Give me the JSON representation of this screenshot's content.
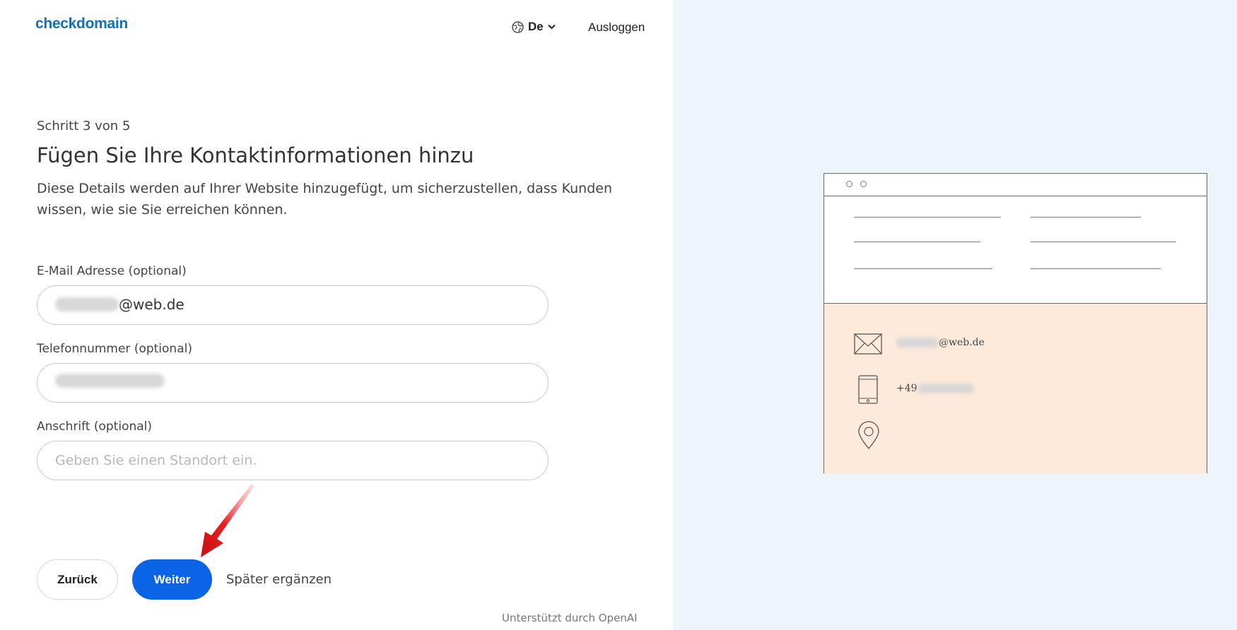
{
  "header": {
    "logo": "checkdomain",
    "language": "De",
    "logout_label": "Ausloggen"
  },
  "form": {
    "step": "Schritt 3 von 5",
    "title": "Fügen Sie Ihre Kontaktinformationen hinzu",
    "description": "Diese Details werden auf Ihrer Website hinzugefügt, um sicherzustellen, dass Kunden wissen, wie sie Sie erreichen können.",
    "email": {
      "label": "E-Mail Adresse (optional)",
      "value_suffix": "@web.de"
    },
    "phone": {
      "label": "Telefonnummer (optional)"
    },
    "address": {
      "label": "Anschrift (optional)",
      "placeholder": "Geben Sie einen Standort ein."
    }
  },
  "actions": {
    "back_label": "Zurück",
    "next_label": "Weiter",
    "later_label": "Später ergänzen"
  },
  "footer": {
    "powered_by": "Unterstützt durch OpenAI"
  },
  "preview": {
    "email_suffix": "@web.de",
    "phone_prefix": "+49"
  },
  "colors": {
    "primary": "#0b63e5",
    "brand": "#1170b8",
    "preview_bg": "#edf4fb",
    "contact_bg": "#fdeadb",
    "annotation_arrow": "#e0151b"
  }
}
